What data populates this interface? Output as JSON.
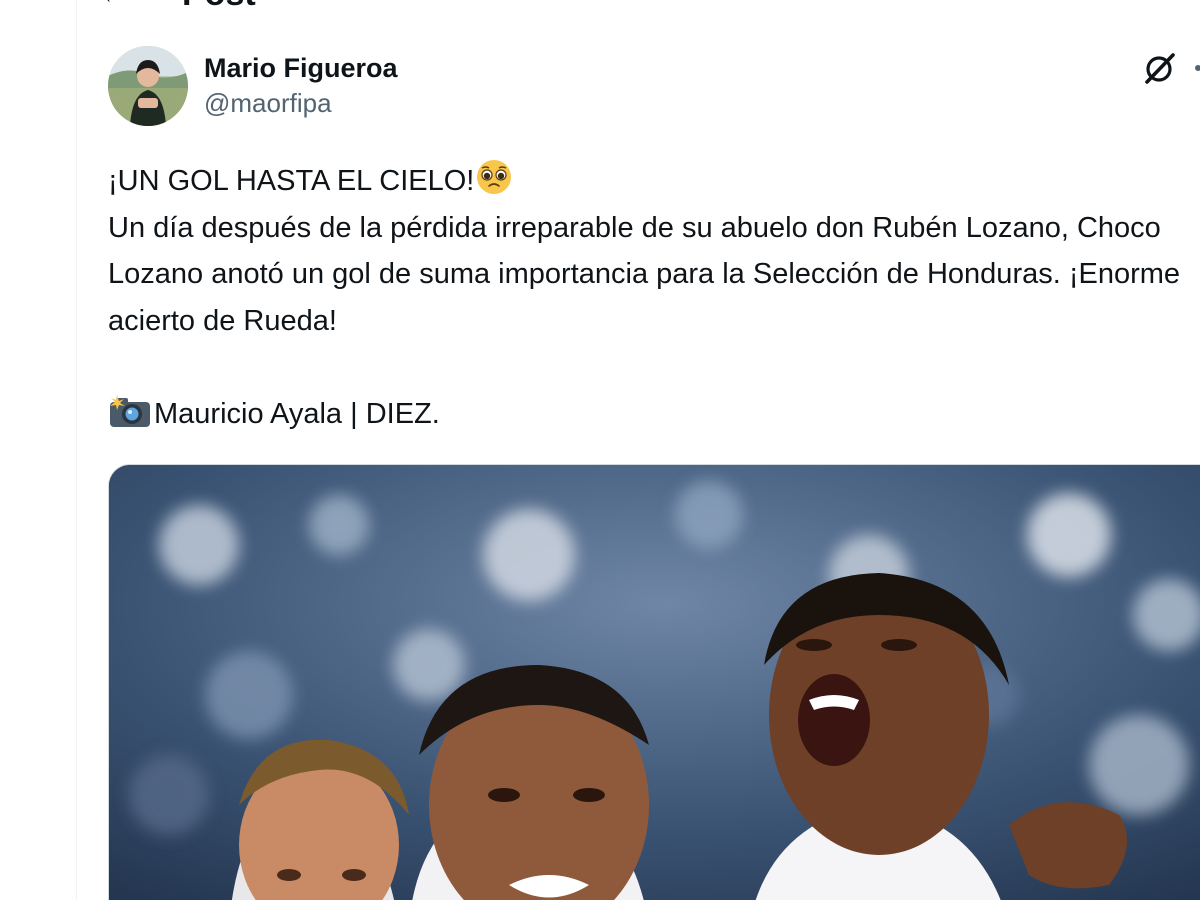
{
  "header": {
    "back_icon": "arrow-left-icon",
    "title": "Post"
  },
  "author": {
    "display_name": "Mario Figueroa",
    "handle": "@maorfipa",
    "avatar_icon": "avatar"
  },
  "actions": {
    "grok_icon": "grok-icon",
    "more_icon": "more-options-icon"
  },
  "tweet": {
    "line1": "¡UN GOL HASTA EL CIELO!",
    "line1_emoji": "pleading-face-emoji",
    "paragraph": "Un día después de la pérdida irreparable de su abuelo don Rubén Lozano, Choco Lozano anotó un gol de suma importancia para la Selección de Honduras. ¡Enorme acierto de Rueda!",
    "credit_emoji": "camera-flash-emoji",
    "credit": "Mauricio Ayala | DIEZ."
  },
  "media": {
    "description_icon": "photo-football-celebration"
  },
  "colors": {
    "text_primary": "#0f1419",
    "text_secondary": "#536471",
    "border": "#cfd9de"
  }
}
